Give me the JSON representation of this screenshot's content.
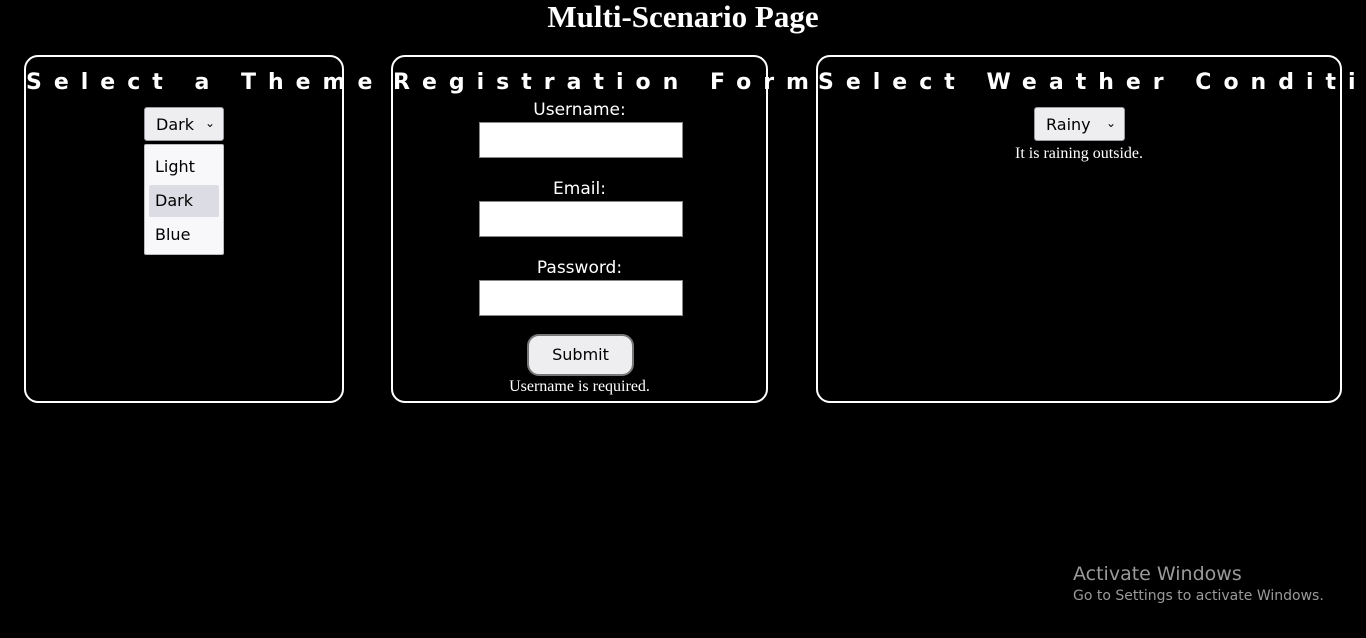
{
  "page": {
    "title": "Multi-Scenario Page"
  },
  "theme": {
    "title": "Select a Theme",
    "selected": "Dark",
    "options": [
      "Light",
      "Dark",
      "Blue"
    ]
  },
  "form": {
    "title": "Registration Form",
    "username_label": "Username:",
    "email_label": "Email:",
    "password_label": "Password:",
    "username_value": "",
    "email_value": "",
    "password_value": "",
    "submit_label": "Submit",
    "message": "Username is required."
  },
  "weather": {
    "title": "Select Weather Condition",
    "selected": "Rainy",
    "message": "It is raining outside."
  },
  "watermark": {
    "title": "Activate Windows",
    "subtitle": "Go to Settings to activate Windows."
  },
  "icons": {
    "select_arrow": "chevron-down-icon"
  }
}
